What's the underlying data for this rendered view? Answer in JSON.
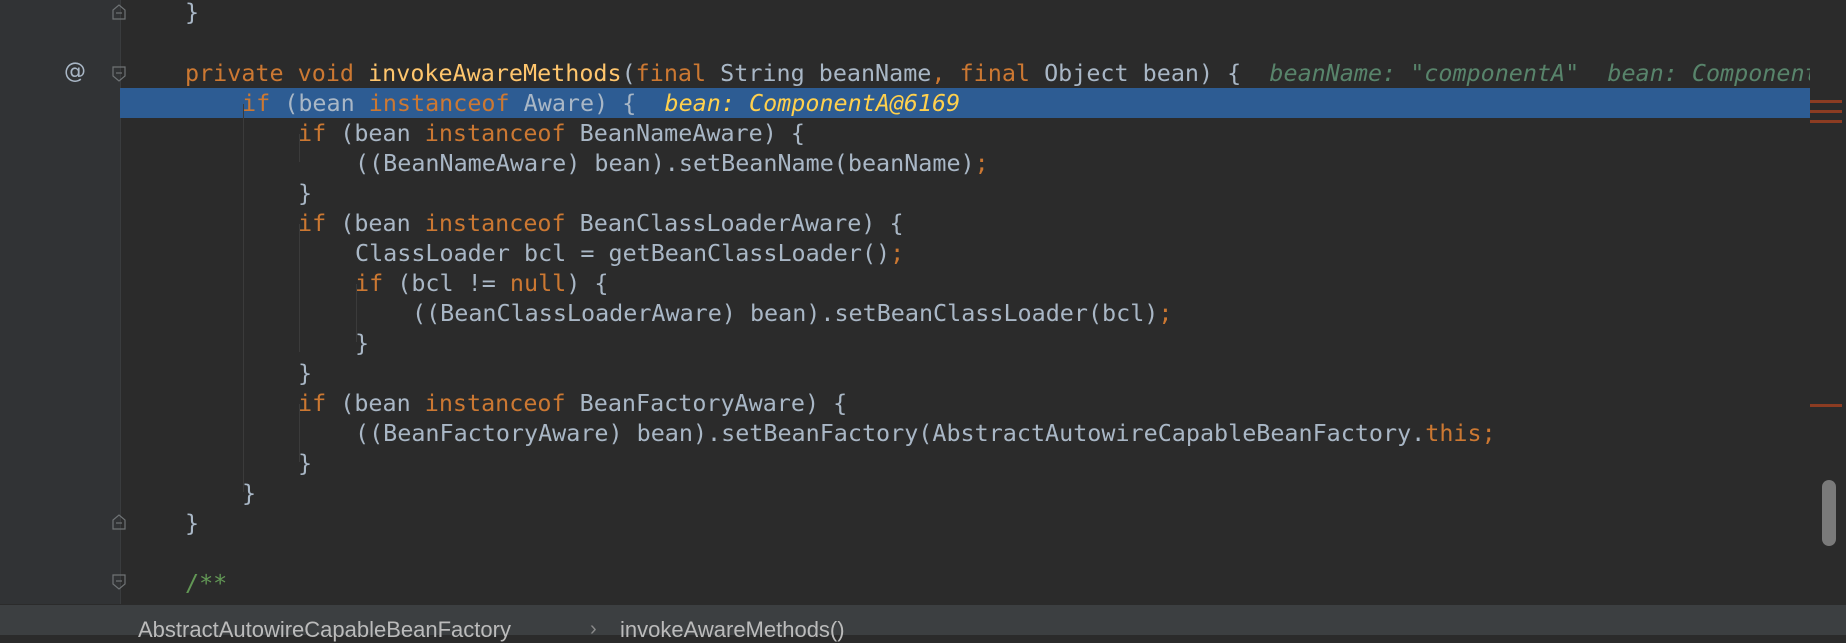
{
  "editor": {
    "lines": [
      {
        "id": "l1",
        "tokens": [
          [
            "plain",
            "}"
          ]
        ]
      },
      {
        "id": "l3",
        "tokens": [
          [
            "kw",
            "private void "
          ],
          [
            "fn",
            "invokeAwareMethods"
          ],
          [
            "plain",
            "("
          ],
          [
            "kw",
            "final "
          ],
          [
            "plain",
            "String beanName"
          ],
          [
            "kw",
            ", final "
          ],
          [
            "plain",
            "Object bean) {"
          ]
        ]
      },
      {
        "id": "l4",
        "tokens": [
          [
            "kw",
            "if "
          ],
          [
            "plain",
            "(bean "
          ],
          [
            "kw",
            "instanceof "
          ],
          [
            "plain",
            "Aware) {"
          ]
        ]
      },
      {
        "id": "l5",
        "tokens": [
          [
            "kw",
            "if "
          ],
          [
            "plain",
            "(bean "
          ],
          [
            "kw",
            "instanceof "
          ],
          [
            "plain",
            "BeanNameAware) {"
          ]
        ]
      },
      {
        "id": "l6",
        "tokens": [
          [
            "plain",
            "((BeanNameAware) bean).setBeanName(beanName)"
          ],
          [
            "kw",
            ";"
          ]
        ]
      },
      {
        "id": "l7",
        "tokens": [
          [
            "plain",
            "}"
          ]
        ]
      },
      {
        "id": "l8",
        "tokens": [
          [
            "kw",
            "if "
          ],
          [
            "plain",
            "(bean "
          ],
          [
            "kw",
            "instanceof "
          ],
          [
            "plain",
            "BeanClassLoaderAware) {"
          ]
        ]
      },
      {
        "id": "l9",
        "tokens": [
          [
            "plain",
            "ClassLoader bcl = getBeanClassLoader()"
          ],
          [
            "kw",
            ";"
          ]
        ]
      },
      {
        "id": "l10",
        "tokens": [
          [
            "kw",
            "if "
          ],
          [
            "plain",
            "(bcl != "
          ],
          [
            "kw",
            "null"
          ],
          [
            "plain",
            ") {"
          ]
        ]
      },
      {
        "id": "l11",
        "tokens": [
          [
            "plain",
            "((BeanClassLoaderAware) bean).setBeanClassLoader(bcl)"
          ],
          [
            "kw",
            ";"
          ]
        ]
      },
      {
        "id": "l12",
        "tokens": [
          [
            "plain",
            "}"
          ]
        ]
      },
      {
        "id": "l13",
        "tokens": [
          [
            "plain",
            "}"
          ]
        ]
      },
      {
        "id": "l14",
        "tokens": [
          [
            "kw",
            "if "
          ],
          [
            "plain",
            "(bean "
          ],
          [
            "kw",
            "instanceof "
          ],
          [
            "plain",
            "BeanFactoryAware) {"
          ]
        ]
      },
      {
        "id": "l15",
        "tokens": [
          [
            "plain",
            "((BeanFactoryAware) bean).setBeanFactory(AbstractAutowireCapableBeanFactory."
          ],
          [
            "kw",
            "this"
          ],
          [
            "kw",
            ";"
          ]
        ]
      },
      {
        "id": "l16",
        "tokens": [
          [
            "plain",
            "}"
          ]
        ]
      },
      {
        "id": "l17",
        "tokens": [
          [
            "plain",
            "}"
          ]
        ]
      },
      {
        "id": "l18",
        "tokens": [
          [
            "plain",
            "}"
          ]
        ]
      },
      {
        "id": "l20",
        "tokens": [
          [
            "cm",
            "/**"
          ]
        ]
      }
    ],
    "hints": {
      "method_params": "beanName: \"componentA\"  bean: ComponentA@",
      "current_line": "bean: ComponentA@6169"
    },
    "gutter_marker": "@"
  },
  "breadcrumb": {
    "class_name": "AbstractAutowireCapableBeanFactory",
    "separator": "›",
    "method_name": "invokeAwareMethods()"
  },
  "colors": {
    "background": "#2b2b2b",
    "keyword": "#cc7832",
    "method": "#ffc66d",
    "text": "#a9b7c6",
    "comment": "#629755",
    "execution_line": "#2d5c93",
    "hint_yellow": "#ffd04d",
    "hint_green": "#58846b"
  }
}
